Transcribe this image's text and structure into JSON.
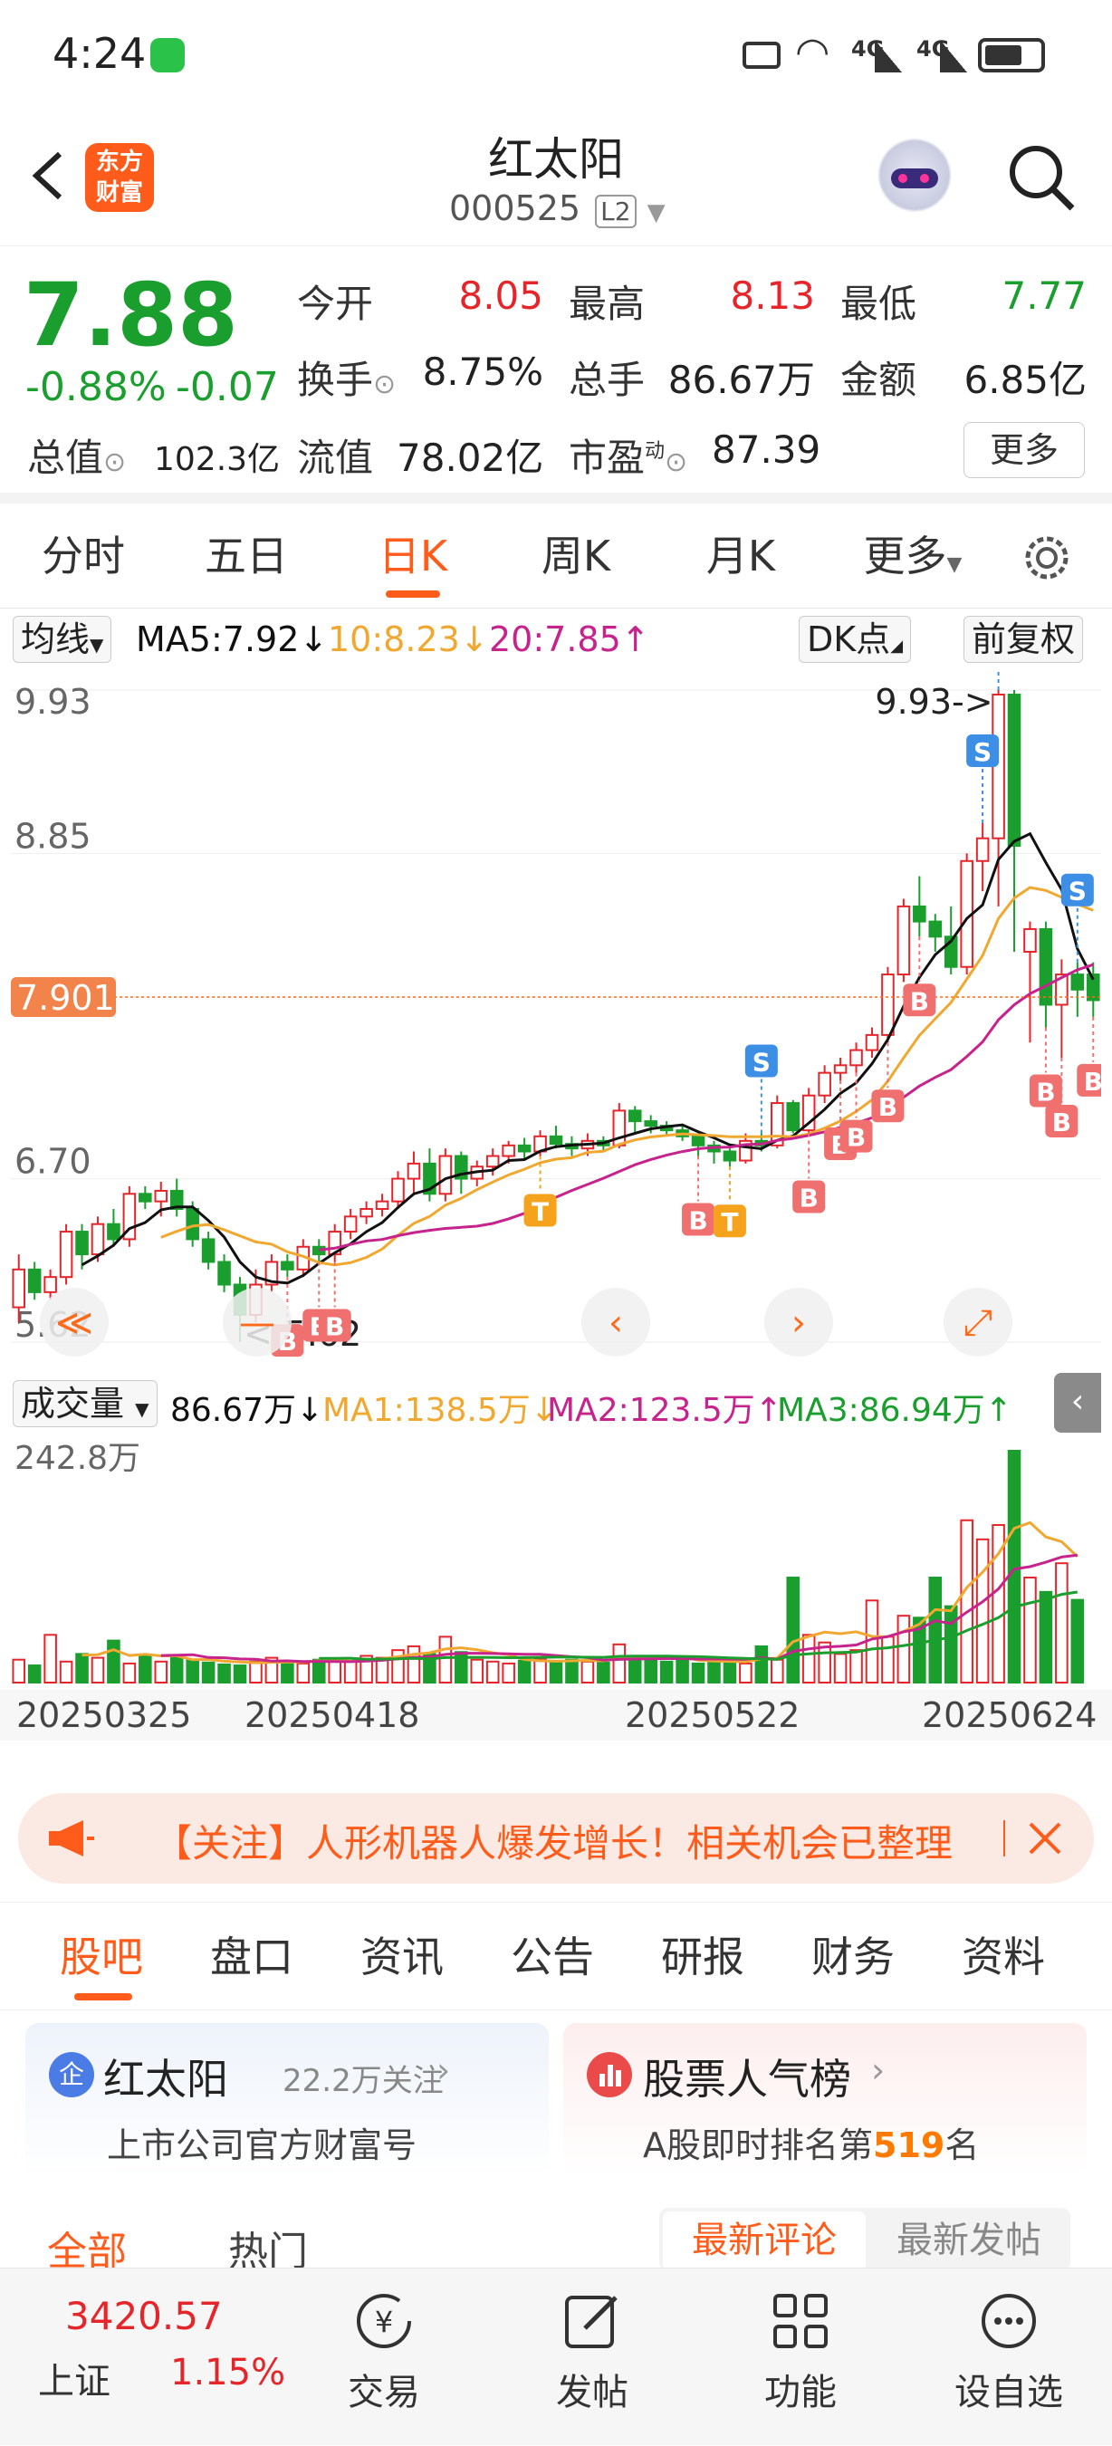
{
  "status": {
    "time": "4:24",
    "network1": "4G",
    "network2": "4G"
  },
  "header": {
    "logo_line1": "东方",
    "logo_line2": "财富",
    "stock_name": "红太阳",
    "stock_code": "000525",
    "level": "L2"
  },
  "quote": {
    "price": "7.88",
    "change_pct": "-0.88%",
    "change": "-0.07",
    "open_label": "今开",
    "open": "8.05",
    "high_label": "最高",
    "high": "8.13",
    "low_label": "最低",
    "low": "7.77",
    "turnover_label": "换手",
    "turnover": "8.75%",
    "volume_label": "总手",
    "volume": "86.67万",
    "amount_label": "金额",
    "amount": "6.85亿",
    "mktcap_label": "总值",
    "mktcap": "102.3亿",
    "float_label": "流值",
    "float_cap": "78.02亿",
    "pe_label": "市盈",
    "pe_sup": "动",
    "pe": "87.39",
    "more": "更多"
  },
  "period_tabs": [
    "分时",
    "五日",
    "日K",
    "周K",
    "月K",
    "更多"
  ],
  "period_active": "日K",
  "kline_bar": {
    "ma_select": "均线",
    "ma5": "MA5:7.92↓",
    "ma10": "10:8.23↓",
    "ma20": "20:7.85↑",
    "dk": "DK点",
    "adjust": "前复权"
  },
  "colors": {
    "up": "#e5252a",
    "down": "#1a9e2e",
    "ma5": "#111111",
    "ma10": "#f0a830",
    "ma20": "#c6238c",
    "accent": "#ff6a1a"
  },
  "chart_data": [
    {
      "type": "candlestick",
      "title": "",
      "y_tick_labels": [
        "9.93",
        "8.85",
        "6.70",
        "5.62"
      ],
      "ylim": [
        5.62,
        9.93
      ],
      "current_price_label": "7.901",
      "max_label": "9.93->",
      "min_label": "<-5.62",
      "x_tick_labels": [
        "20250325",
        "20250418",
        "20250522",
        "20250624"
      ],
      "markers": [
        "B",
        "S",
        "T"
      ],
      "candles": [
        {
          "o": 5.85,
          "c": 6.1,
          "h": 6.2,
          "l": 5.75
        },
        {
          "o": 6.1,
          "c": 5.95,
          "h": 6.15,
          "l": 5.9
        },
        {
          "o": 5.95,
          "c": 6.05,
          "h": 6.1,
          "l": 5.9
        },
        {
          "o": 6.05,
          "c": 6.35,
          "h": 6.4,
          "l": 6.0
        },
        {
          "o": 6.35,
          "c": 6.2,
          "h": 6.4,
          "l": 6.1
        },
        {
          "o": 6.2,
          "c": 6.4,
          "h": 6.45,
          "l": 6.15
        },
        {
          "o": 6.4,
          "c": 6.3,
          "h": 6.5,
          "l": 6.25
        },
        {
          "o": 6.3,
          "c": 6.6,
          "h": 6.65,
          "l": 6.25
        },
        {
          "o": 6.6,
          "c": 6.55,
          "h": 6.65,
          "l": 6.5
        },
        {
          "o": 6.55,
          "c": 6.62,
          "h": 6.68,
          "l": 6.45
        },
        {
          "o": 6.62,
          "c": 6.5,
          "h": 6.7,
          "l": 6.45
        },
        {
          "o": 6.5,
          "c": 6.3,
          "h": 6.55,
          "l": 6.25
        },
        {
          "o": 6.3,
          "c": 6.15,
          "h": 6.35,
          "l": 6.1
        },
        {
          "o": 6.15,
          "c": 6.0,
          "h": 6.2,
          "l": 5.95
        },
        {
          "o": 6.0,
          "c": 5.8,
          "h": 6.05,
          "l": 5.62
        },
        {
          "o": 5.8,
          "c": 6.0,
          "h": 6.1,
          "l": 5.75
        },
        {
          "o": 6.0,
          "c": 6.15,
          "h": 6.2,
          "l": 5.95
        },
        {
          "o": 6.15,
          "c": 6.1,
          "h": 6.2,
          "l": 6.05
        },
        {
          "o": 6.1,
          "c": 6.25,
          "h": 6.3,
          "l": 6.05
        },
        {
          "o": 6.25,
          "c": 6.2,
          "h": 6.3,
          "l": 6.15
        },
        {
          "o": 6.2,
          "c": 6.35,
          "h": 6.4,
          "l": 6.15
        },
        {
          "o": 6.35,
          "c": 6.45,
          "h": 6.5,
          "l": 6.3
        },
        {
          "o": 6.45,
          "c": 6.5,
          "h": 6.55,
          "l": 6.4
        },
        {
          "o": 6.5,
          "c": 6.55,
          "h": 6.6,
          "l": 6.45
        },
        {
          "o": 6.55,
          "c": 6.7,
          "h": 6.75,
          "l": 6.5
        },
        {
          "o": 6.7,
          "c": 6.8,
          "h": 6.88,
          "l": 6.6
        },
        {
          "o": 6.8,
          "c": 6.6,
          "h": 6.9,
          "l": 6.55
        },
        {
          "o": 6.6,
          "c": 6.85,
          "h": 6.9,
          "l": 6.55
        },
        {
          "o": 6.85,
          "c": 6.7,
          "h": 6.88,
          "l": 6.6
        },
        {
          "o": 6.7,
          "c": 6.78,
          "h": 6.82,
          "l": 6.65
        },
        {
          "o": 6.78,
          "c": 6.85,
          "h": 6.9,
          "l": 6.72
        },
        {
          "o": 6.85,
          "c": 6.92,
          "h": 6.95,
          "l": 6.8
        },
        {
          "o": 6.92,
          "c": 6.88,
          "h": 6.97,
          "l": 6.82
        },
        {
          "o": 6.88,
          "c": 6.98,
          "h": 7.02,
          "l": 6.85
        },
        {
          "o": 6.98,
          "c": 6.93,
          "h": 7.05,
          "l": 6.9
        },
        {
          "o": 6.93,
          "c": 6.9,
          "h": 6.98,
          "l": 6.85
        },
        {
          "o": 6.9,
          "c": 6.95,
          "h": 7.0,
          "l": 6.85
        },
        {
          "o": 6.95,
          "c": 6.92,
          "h": 6.98,
          "l": 6.88
        },
        {
          "o": 6.92,
          "c": 7.15,
          "h": 7.2,
          "l": 6.9
        },
        {
          "o": 7.15,
          "c": 7.08,
          "h": 7.18,
          "l": 7.0
        },
        {
          "o": 7.08,
          "c": 7.05,
          "h": 7.12,
          "l": 7.0
        },
        {
          "o": 7.05,
          "c": 7.02,
          "h": 7.08,
          "l": 6.98
        },
        {
          "o": 7.02,
          "c": 6.98,
          "h": 7.05,
          "l": 6.95
        },
        {
          "o": 6.98,
          "c": 6.92,
          "h": 7.0,
          "l": 6.85
        },
        {
          "o": 6.92,
          "c": 6.88,
          "h": 6.95,
          "l": 6.8
        },
        {
          "o": 6.88,
          "c": 6.82,
          "h": 6.9,
          "l": 6.78
        },
        {
          "o": 6.82,
          "c": 6.95,
          "h": 7.0,
          "l": 6.8
        },
        {
          "o": 6.95,
          "c": 6.92,
          "h": 7.0,
          "l": 6.88
        },
        {
          "o": 6.92,
          "c": 7.2,
          "h": 7.25,
          "l": 6.9
        },
        {
          "o": 7.2,
          "c": 7.02,
          "h": 7.22,
          "l": 7.0
        },
        {
          "o": 7.02,
          "c": 7.25,
          "h": 7.3,
          "l": 7.0
        },
        {
          "o": 7.25,
          "c": 7.4,
          "h": 7.45,
          "l": 7.2
        },
        {
          "o": 7.4,
          "c": 7.45,
          "h": 7.5,
          "l": 7.35
        },
        {
          "o": 7.45,
          "c": 7.55,
          "h": 7.6,
          "l": 7.4
        },
        {
          "o": 7.55,
          "c": 7.65,
          "h": 7.7,
          "l": 7.5
        },
        {
          "o": 7.65,
          "c": 8.05,
          "h": 8.1,
          "l": 7.6
        },
        {
          "o": 8.05,
          "c": 8.5,
          "h": 8.55,
          "l": 8.0
        },
        {
          "o": 8.5,
          "c": 8.4,
          "h": 8.7,
          "l": 8.3
        },
        {
          "o": 8.4,
          "c": 8.3,
          "h": 8.45,
          "l": 8.2
        },
        {
          "o": 8.3,
          "c": 8.1,
          "h": 8.5,
          "l": 8.05
        },
        {
          "o": 8.1,
          "c": 8.8,
          "h": 8.85,
          "l": 8.05
        },
        {
          "o": 8.8,
          "c": 8.95,
          "h": 9.05,
          "l": 8.6
        },
        {
          "o": 8.95,
          "c": 9.9,
          "h": 9.93,
          "l": 8.5
        },
        {
          "o": 9.9,
          "c": 8.9,
          "h": 9.93,
          "l": 8.2
        },
        {
          "o": 8.2,
          "c": 8.35,
          "h": 8.4,
          "l": 7.6
        },
        {
          "o": 8.35,
          "c": 7.85,
          "h": 8.4,
          "l": 7.7
        },
        {
          "o": 7.85,
          "c": 8.05,
          "h": 8.15,
          "l": 7.5
        },
        {
          "o": 8.05,
          "c": 7.95,
          "h": 8.13,
          "l": 7.77
        },
        {
          "o": 8.05,
          "c": 7.88,
          "h": 8.13,
          "l": 7.77
        }
      ]
    },
    {
      "type": "bar",
      "title": "",
      "y_tick_labels": [
        "242.8万"
      ],
      "ylim": [
        0,
        242.8
      ],
      "volume_wan": [
        24,
        18,
        50,
        22,
        30,
        26,
        44,
        20,
        28,
        22,
        26,
        24,
        21,
        19,
        18,
        22,
        26,
        22,
        20,
        24,
        25,
        22,
        28,
        26,
        34,
        38,
        30,
        48,
        32,
        24,
        22,
        20,
        23,
        25,
        22,
        24,
        22,
        21,
        40,
        28,
        24,
        22,
        23,
        20,
        24,
        22,
        20,
        38,
        24,
        110,
        50,
        42,
        30,
        34,
        86,
        48,
        70,
        68,
        110,
        80,
        170,
        150,
        165,
        242.8,
        110,
        95,
        125,
        86.67
      ]
    }
  ],
  "volume_bar": {
    "select": "成交量",
    "vol": "86.67万↓",
    "ma1": "MA1:138.5万↓",
    "ma2": "MA2:123.5万↑",
    "ma3": "MA3:86.94万↑"
  },
  "banner": {
    "text": "【关注】人形机器人爆发增长！相关机会已整理"
  },
  "section_tabs": [
    "股吧",
    "盘口",
    "资讯",
    "公告",
    "研报",
    "财务",
    "资料"
  ],
  "section_active": "股吧",
  "card1": {
    "badge": "企",
    "name": "红太阳",
    "followers": "22.2万关注",
    "subtitle": "上市公司官方财富号"
  },
  "card2": {
    "title": "股票人气榜",
    "subtitle_pre": "A股即时排名第",
    "rank": "519",
    "subtitle_post": "名"
  },
  "filter": {
    "all": "全部",
    "hot": "热门",
    "latest_comment": "最新评论",
    "latest_post": "最新发帖"
  },
  "bottom_nav": {
    "index_value": "3420.57",
    "index_name": "上证",
    "index_change": "1.15%",
    "items": [
      "交易",
      "发帖",
      "功能",
      "设自选"
    ]
  }
}
